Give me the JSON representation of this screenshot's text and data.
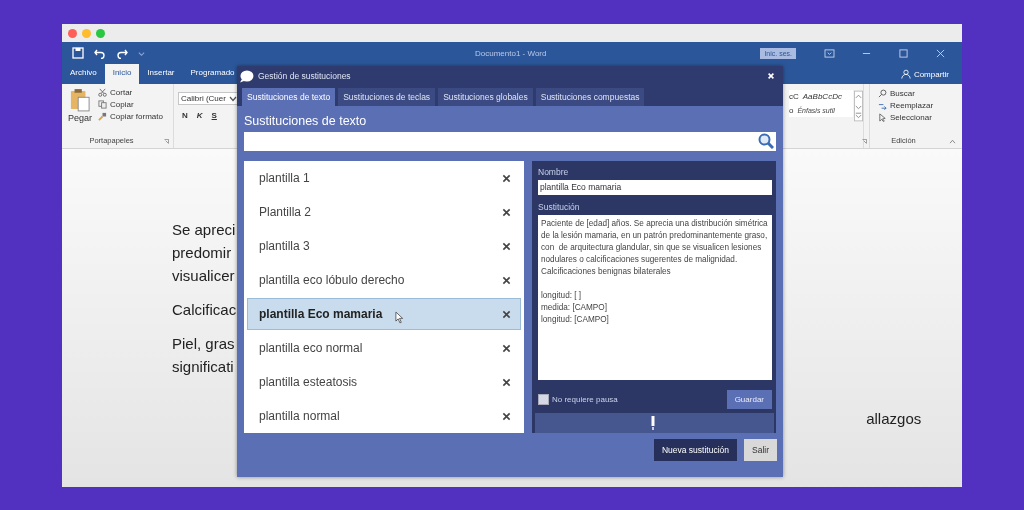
{
  "window": {
    "title": "Documento1 - Word",
    "sign_in": "Inic. ses."
  },
  "ribbon_tabs": [
    {
      "label": "Archivo",
      "selected": false
    },
    {
      "label": "Inicio",
      "selected": true
    },
    {
      "label": "Insertar",
      "selected": false
    },
    {
      "label": "Programado",
      "selected": false
    }
  ],
  "share": "Compartir",
  "clipboard": {
    "paste": "Pegar",
    "items": [
      "Cortar",
      "Copiar",
      "Copiar formato"
    ],
    "group": "Portapapeles"
  },
  "font": {
    "name": "Calibri (Cuer",
    "format_buttons": [
      {
        "label": "N",
        "kind": "bold"
      },
      {
        "label": "K",
        "kind": "italic"
      },
      {
        "label": "S",
        "kind": "underline"
      }
    ]
  },
  "styles": {
    "fragment_top": "cC",
    "sample": "AaBbCcDc",
    "fragment_bottom": "o",
    "name": "Énfasis sutil"
  },
  "editing": {
    "items": [
      "Buscar",
      "Reemplazar",
      "Seleccionar"
    ],
    "group": "Edición"
  },
  "document": {
    "paragraphs": [
      [
        "Se apreci",
        "predomir",
        "visualicer"
      ],
      [
        "Calcificac"
      ],
      [
        "Piel, gras",
        "significati"
      ]
    ],
    "right_text": "allazgos"
  },
  "dialog": {
    "title": "Gestión de sustituciones",
    "tabs": [
      {
        "label": "Sustituciones de texto",
        "selected": true
      },
      {
        "label": "Sustituciones de teclas",
        "selected": false
      },
      {
        "label": "Sustituciones globales",
        "selected": false
      },
      {
        "label": "Sustituciones compuestas",
        "selected": false
      }
    ],
    "heading": "Sustituciones de texto",
    "templates": [
      {
        "name": "plantilla 1",
        "selected": false
      },
      {
        "name": "Plantilla 2",
        "selected": false
      },
      {
        "name": "plantilla 3",
        "selected": false
      },
      {
        "name": "plantilla eco lóbulo derecho",
        "selected": false
      },
      {
        "name": "plantilla Eco mamaria",
        "selected": true
      },
      {
        "name": "plantilla eco normal",
        "selected": false
      },
      {
        "name": "plantilla esteatosis",
        "selected": false
      },
      {
        "name": "plantilla normal",
        "selected": false
      }
    ],
    "name_label": "Nombre",
    "name_value": "plantilla Eco mamaria",
    "text_label": "Sustitución",
    "text_value": "Paciente de [edad] años. Se aprecia una distribución simétrica de la lesión mamaria, en un patrón predominantemente graso, con  de arquitectura glandular, sin que se visualicen lesiones nodulares o calcificaciones sugerentes de malignidad.\nCalcificaciones benignas bilaterales\n\nlongitud: [ ]\nmedida: [CAMPO]\nlongitud: [CAMPO]",
    "no_pause": {
      "label": "No requiere pausa",
      "checked": false
    },
    "save": "Guardar",
    "buttons": [
      {
        "label": "Nueva sustitución",
        "kind": "primary"
      },
      {
        "label": "Salir",
        "kind": "secondary"
      }
    ]
  }
}
